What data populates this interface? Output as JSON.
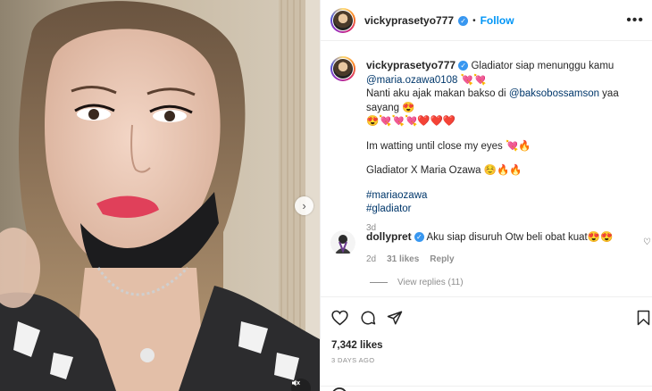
{
  "post": {
    "author": "vickyprasetyo777",
    "follow_label": "Follow",
    "dot": "•",
    "more": "•••"
  },
  "caption": {
    "username": "vickyprasetyo777",
    "line1": "Gladiator siap menunggu kamu",
    "mention1": "@maria.ozawa0108",
    "line1_emoji": "💘💘",
    "line2_pre": "Nanti aku ajak makan bakso di ",
    "mention2": "@baksobossamson",
    "line2_post": " yaa sayang 😍",
    "line3": "😍💘💘💘❤️❤️❤️",
    "line4": "Im watting until close my eyes 💘🔥",
    "line5": "Gladiator X Maria Ozawa ☺️🔥🔥",
    "hashtag1": "#mariaozawa",
    "hashtag2": "#gladiator",
    "time": "3d"
  },
  "comment": {
    "username": "dollypret",
    "text": "Aku siap disuruh Otw beli obat kuat😍😍",
    "time": "2d",
    "likes": "31 likes",
    "reply": "Reply",
    "view_replies": "View replies (11)"
  },
  "stats": {
    "likes": "7,342 likes",
    "ago": "3 DAYS AGO"
  },
  "icons": {
    "like": "heart-icon",
    "comment": "comment-icon",
    "share": "share-icon",
    "save": "bookmark-icon",
    "next": "chevron-right-icon",
    "mute": "mute-icon"
  }
}
